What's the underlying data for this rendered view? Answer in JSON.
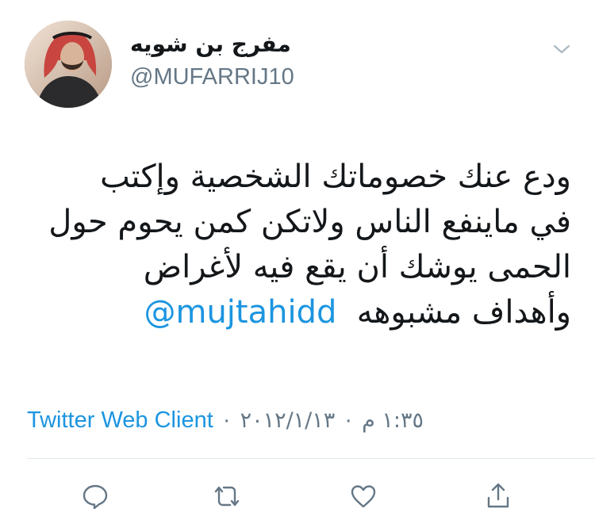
{
  "user": {
    "display_name": "مفرج بن شويه",
    "handle": "@MUFARRIJ10"
  },
  "tweet": {
    "text_lines": [
      "ودع عنك خصوماتك الشخصية وإكتب",
      "في ماينفع الناس ولاتكن كمن يحوم حول",
      "الحمى يوشك أن يقع فيه لأغراض",
      "وأهداف مشبوهه"
    ],
    "mention": "@mujtahidd"
  },
  "meta": {
    "time": "١:٣٥ م",
    "date": "٢٠١٢/١/١٣",
    "client": "Twitter Web Client",
    "separator": "·"
  },
  "icons": {
    "menu": "chevron-down-icon",
    "reply": "reply-icon",
    "retweet": "retweet-icon",
    "like": "heart-icon",
    "share": "share-icon"
  },
  "colors": {
    "link": "#1b95e0",
    "secondary_text": "#657786",
    "divider": "#e1e8ed",
    "primary_text": "#14171a"
  }
}
